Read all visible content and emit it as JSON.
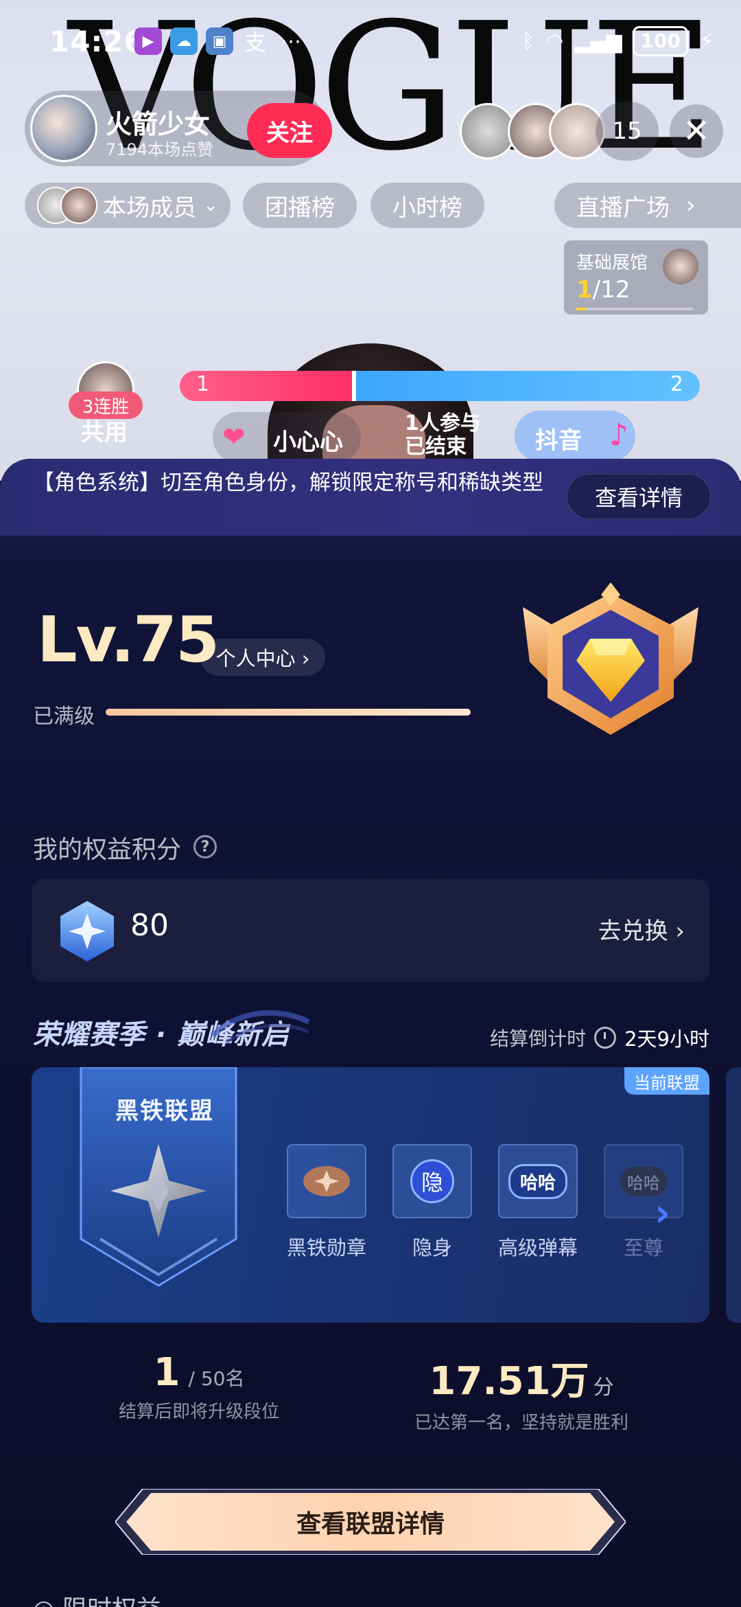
{
  "status_bar": {
    "time": "14:26",
    "battery": "100"
  },
  "overlay": {
    "logo_text": "VOGUE"
  },
  "host": {
    "name": "火箭少女",
    "likes": "7194本场点赞",
    "follow_label": "关注"
  },
  "viewers": {
    "count": "15",
    "close_icon": "close-icon"
  },
  "nav_pills": {
    "members": "本场成员",
    "group_rank": "团播榜",
    "hour_rank": "小时榜",
    "plaza": "直播广场"
  },
  "exhibition": {
    "title": "基础展馆",
    "current": "1",
    "total": "/12"
  },
  "pk": {
    "streak": "3连胜",
    "left_score": "1",
    "right_score": "2",
    "left_fraction": 0.335
  },
  "row3": {
    "shared": "共用",
    "heart_label": "小心心",
    "participants": "1人参与",
    "ended": "已结束",
    "douyin": "抖音"
  },
  "panel": {
    "banner_text": "【角色系统】切至角色身份，解锁限定称号和稀缺类型",
    "banner_button": "查看详情",
    "level": "Lv.75",
    "personal_center": "个人中心 ›",
    "maxed_label": "已满级",
    "points_title": "我的权益积分",
    "points_value": "80",
    "redeem_label": "去兑换 ›"
  },
  "season": {
    "title": "荣耀赛季 · 巅峰新启",
    "countdown_label": "结算倒计时",
    "countdown_value": "2天9小时",
    "current_tag": "当前联盟",
    "league_name": "黑铁联盟",
    "perks": [
      {
        "label": "黑铁勋章",
        "icon": "iron-medal-icon"
      },
      {
        "label": "隐身",
        "icon_text": "隐"
      },
      {
        "label": "高级弹幕",
        "icon_text": "哈哈"
      },
      {
        "label": "至尊",
        "icon_text": "哈哈"
      }
    ]
  },
  "stats": {
    "rank": "1",
    "rank_total": "/ 50名",
    "rank_caption": "结算后即将升级段位",
    "score": "17.51万",
    "score_unit": "分",
    "score_caption": "已达第一名，坚持就是胜利"
  },
  "cta": {
    "label": "查看联盟详情"
  },
  "bottom": {
    "next_section": "限时权益"
  },
  "colors": {
    "follow": "#fe2c55",
    "gold_text": "#fde9c2",
    "panel_bg": "#0e1030",
    "league_bg": "#1a3577"
  }
}
